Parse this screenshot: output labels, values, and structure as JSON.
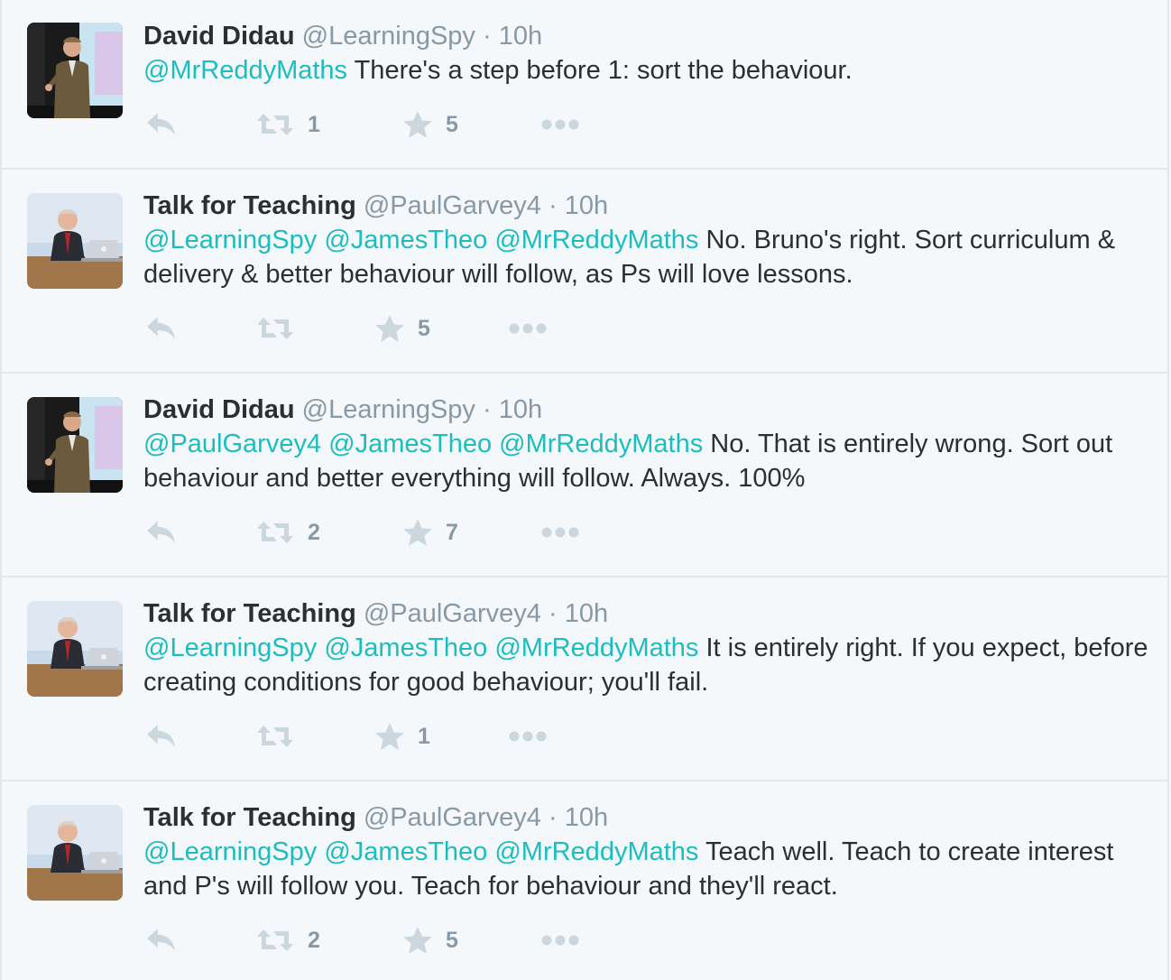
{
  "colors": {
    "mention": "#1dbdbf",
    "meta": "#8899a6",
    "icon": "#ccd6dd",
    "background": "#f5f8fa"
  },
  "icons": {
    "reply": "reply-arrow-icon",
    "retweet": "retweet-arrows-icon",
    "favorite": "star-icon",
    "more": "three-dots-icon"
  },
  "tweets": [
    {
      "name": "David Didau",
      "handle": "@LearningSpy",
      "sep": " · ",
      "time": "10h",
      "mentions": [
        "@MrReddyMaths"
      ],
      "text": " There's a step before 1: sort the behaviour.",
      "retweets": "1",
      "favorites": "5"
    },
    {
      "name": "Talk for Teaching",
      "handle": "@PaulGarvey4",
      "sep": " · ",
      "time": "10h",
      "mentions": [
        "@LearningSpy",
        "@JamesTheo",
        "@MrReddyMaths"
      ],
      "text": " No. Bruno's right. Sort curriculum & delivery & better behaviour will follow, as Ps will love lessons.",
      "retweets": "",
      "favorites": "5"
    },
    {
      "name": "David Didau",
      "handle": "@LearningSpy",
      "sep": " · ",
      "time": "10h",
      "mentions": [
        "@PaulGarvey4",
        "@JamesTheo",
        "@MrReddyMaths"
      ],
      "text": " No. That is entirely wrong. Sort out behaviour and better everything will follow. Always. 100%",
      "retweets": "2",
      "favorites": "7"
    },
    {
      "name": "Talk for Teaching",
      "handle": "@PaulGarvey4",
      "sep": " · ",
      "time": "10h",
      "mentions": [
        "@LearningSpy",
        "@JamesTheo",
        "@MrReddyMaths"
      ],
      "text": " It is entirely right. If you expect, before creating conditions for good behaviour; you'll fail.",
      "retweets": "",
      "favorites": "1"
    },
    {
      "name": "Talk for Teaching",
      "handle": "@PaulGarvey4",
      "sep": " · ",
      "time": "10h",
      "mentions": [
        "@LearningSpy",
        "@JamesTheo",
        "@MrReddyMaths"
      ],
      "text": " Teach well. Teach to create interest and P's will follow you. Teach for behaviour and they'll react.",
      "retweets": "2",
      "favorites": "5"
    }
  ]
}
